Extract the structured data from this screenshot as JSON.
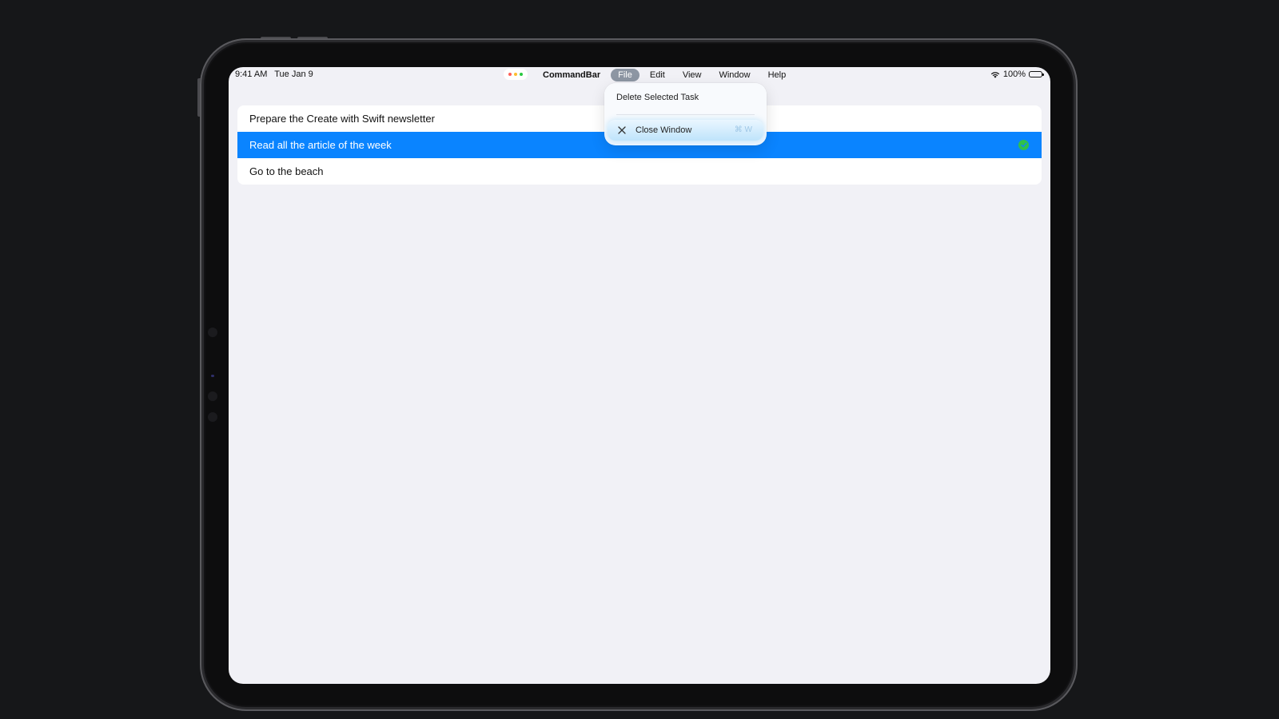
{
  "status_bar": {
    "time": "9:41 AM",
    "date": "Tue Jan 9",
    "battery": "100%",
    "icons": [
      "wifi-icon",
      "battery-icon"
    ]
  },
  "multitask_dots": [
    "#ff5f57",
    "#febc2e",
    "#28c840"
  ],
  "menu_bar": {
    "app_name": "CommandBar",
    "items": [
      "File",
      "Edit",
      "View",
      "Window",
      "Help"
    ],
    "active_item": "File"
  },
  "file_menu": {
    "items": [
      {
        "label": "Delete Selected Task"
      },
      {
        "label": "Close Window",
        "icon": "close-icon",
        "shortcut": "⌘ W",
        "highlighted": true
      }
    ]
  },
  "tasks": [
    {
      "title": "Prepare the Create with Swift newsletter",
      "selected": false
    },
    {
      "title": "Read all the article of the week",
      "selected": true,
      "icon": "check-icon"
    },
    {
      "title": "Go to the beach",
      "selected": false
    }
  ],
  "colors": {
    "selection": "#0a84ff",
    "check": "#2fc14a",
    "menu_active": "#8d96a3",
    "screen_bg": "#f1f1f6"
  }
}
